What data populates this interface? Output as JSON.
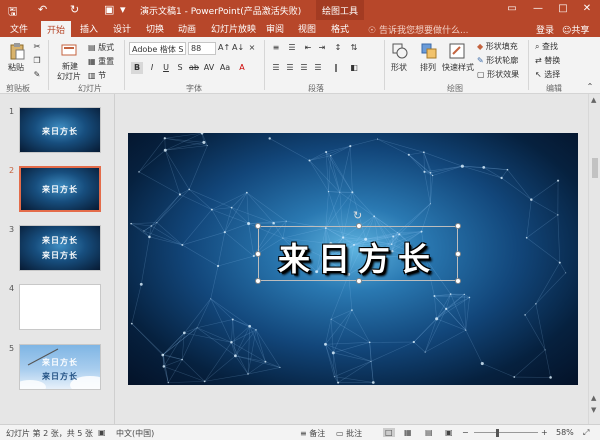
{
  "app": {
    "title": "演示文稿1 - PowerPoint(产品激活失败)",
    "context_tool": "绘图工具"
  },
  "tabs": [
    "文件",
    "开始",
    "插入",
    "设计",
    "切换",
    "动画",
    "幻灯片放映",
    "审阅",
    "视图",
    "格式"
  ],
  "tell_me": "告诉我您想要做什么...",
  "account": {
    "login": "登录",
    "share": "共享"
  },
  "ribbon": {
    "clipboard": {
      "paste": "粘贴",
      "label": "剪贴板"
    },
    "slides": {
      "new_slide": "新建",
      "new_slide2": "幻灯片",
      "layout": "版式",
      "reset": "重置",
      "section": "节",
      "label": "幻灯片"
    },
    "font": {
      "name": "Adobe 楷体 S",
      "size": "88",
      "label": "字体"
    },
    "paragraph": {
      "label": "段落"
    },
    "drawing": {
      "shapes": "形状",
      "arrange": "排列",
      "quick_styles": "快速样式",
      "fill": "形状填充",
      "outline": "形状轮廓",
      "effects": "形状效果",
      "label": "绘图"
    },
    "editing": {
      "find": "查找",
      "replace": "替换",
      "select": "选择",
      "label": "编辑"
    }
  },
  "slides": [
    {
      "num": "1",
      "title": "来日方长"
    },
    {
      "num": "2",
      "title": "来日方长"
    },
    {
      "num": "3",
      "title": "来日方长",
      "subtitle": "来日方长"
    },
    {
      "num": "4",
      "title": ""
    },
    {
      "num": "5",
      "title": "来日方长",
      "subtitle": "来日方长"
    }
  ],
  "main_slide": {
    "title": "来日方长"
  },
  "status": {
    "slide_info": "幻灯片 第 2 张，共 5 张",
    "language": "中文(中国)",
    "notes": "备注",
    "comments": "批注",
    "zoom": "58%"
  }
}
